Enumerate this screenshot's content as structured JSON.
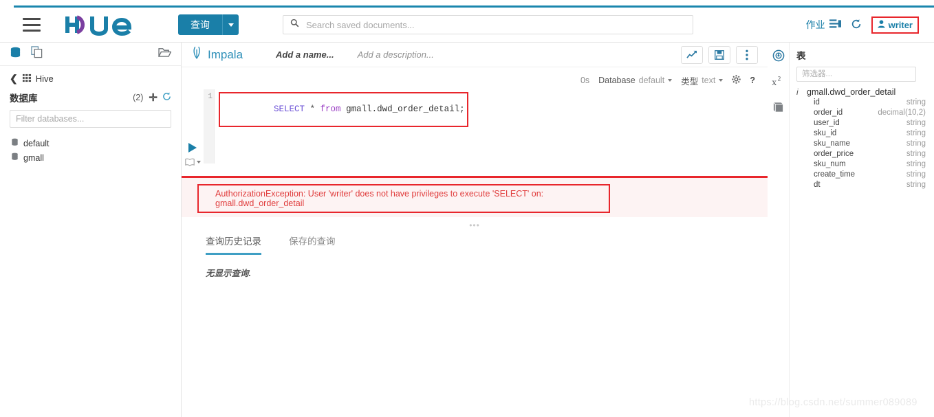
{
  "theme": {
    "accent": "#1a86ad",
    "primary_blue": "#1a7fa8",
    "link_blue": "#2d8fb8",
    "error_red": "#e8262c",
    "error_text": "#e03b3b",
    "error_bg": "#fdf3f3"
  },
  "header": {
    "menu_icon": "hamburger-icon",
    "logo_text": "hue",
    "query_button": "查询",
    "query_caret_icon": "chevron-down-icon",
    "search": {
      "icon": "search-icon",
      "placeholder": "Search saved documents...",
      "value": ""
    },
    "jobs_label": "作业",
    "jobs_icon": "jobs-icon",
    "history_icon": "history-icon",
    "user": {
      "icon": "user-icon",
      "name": "writer"
    }
  },
  "left_panel": {
    "top_icons": [
      {
        "name": "database-icon",
        "active": true
      },
      {
        "name": "documents-icon",
        "active": false
      },
      {
        "name": "folder-open-icon",
        "active": false
      }
    ],
    "breadcrumb": {
      "back_icon": "chevron-left-icon",
      "source_icon": "hive-icon",
      "source": "Hive"
    },
    "section_title": "数据库",
    "count": "(2)",
    "add_icon": "plus-icon",
    "refresh_icon": "refresh-icon",
    "filter_placeholder": "Filter databases...",
    "filter_value": "",
    "databases": [
      {
        "icon": "database-small-icon",
        "name": "default"
      },
      {
        "icon": "database-small-icon",
        "name": "gmall"
      }
    ]
  },
  "editor": {
    "engine_icon": "impala-icon",
    "engine": "Impala",
    "name_placeholder": "Add a name...",
    "description_placeholder": "Add a description...",
    "toolbar": [
      {
        "name": "chart-button",
        "icon": "chart-icon"
      },
      {
        "name": "save-button",
        "icon": "floppy-disk-icon"
      },
      {
        "name": "more-button",
        "icon": "vertical-dots-icon"
      }
    ],
    "settings": {
      "duration": "0s",
      "database_label": "Database",
      "database_value": "default",
      "type_label": "类型",
      "type_value": "text",
      "gear_icon": "gear-icon",
      "help_icon": "question-mark-icon"
    },
    "run_icon": "play-icon",
    "assist_icon": "book-icon",
    "code": {
      "line_number": "1",
      "tokens": [
        {
          "text": "SELECT",
          "kind": "keyword"
        },
        {
          "text": " * ",
          "kind": "operator"
        },
        {
          "text": "from",
          "kind": "keyword2"
        },
        {
          "text": " gmall.dwd_order_detail;",
          "kind": "identifier"
        }
      ],
      "full_text": "SELECT * from gmall.dwd_order_detail;"
    },
    "error_message": "AuthorizationException: User 'writer' does not have privileges to execute 'SELECT' on: gmall.dwd_order_detail",
    "drag_handle": "•••",
    "tabs": [
      {
        "label": "查询历史记录",
        "active": true
      },
      {
        "label": "保存的查询",
        "active": false
      }
    ],
    "empty_note": "无显示查询."
  },
  "right_panel": {
    "rail_icons": [
      {
        "name": "assistant-icon"
      },
      {
        "name": "functions-icon",
        "label": "x²"
      },
      {
        "name": "book-icon"
      }
    ],
    "title": "表",
    "filter_placeholder": "筛选器...",
    "filter_value": "",
    "table": {
      "info_icon": "info-icon",
      "name": "gmall.dwd_order_detail",
      "columns": [
        {
          "name": "id",
          "type": "string"
        },
        {
          "name": "order_id",
          "type": "decimal(10,2)"
        },
        {
          "name": "user_id",
          "type": "string"
        },
        {
          "name": "sku_id",
          "type": "string"
        },
        {
          "name": "sku_name",
          "type": "string"
        },
        {
          "name": "order_price",
          "type": "string"
        },
        {
          "name": "sku_num",
          "type": "string"
        },
        {
          "name": "create_time",
          "type": "string"
        },
        {
          "name": "dt",
          "type": "string"
        }
      ]
    }
  },
  "watermark": "https://blog.csdn.net/summer089089"
}
